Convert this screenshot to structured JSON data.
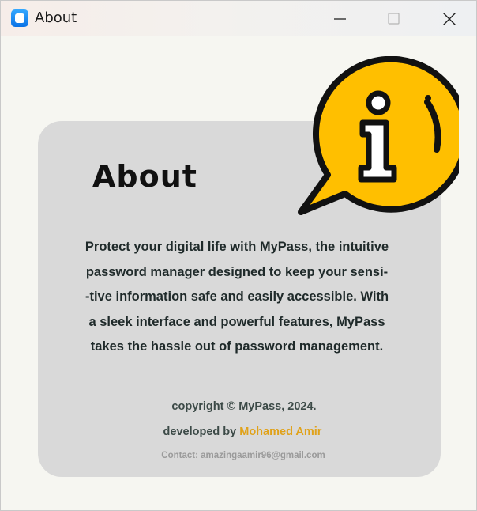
{
  "window": {
    "title": "About",
    "controls": {
      "minimize": "minimize",
      "maximize": "maximize",
      "close": "close"
    }
  },
  "about": {
    "heading": "About",
    "description": [
      "Protect your digital life with MyPass, the intuitive",
      "password manager designed to keep your sensi-",
      "-tive information safe and easily accessible. With",
      "a sleek interface and powerful features, MyPass",
      "takes the hassle out of password management."
    ],
    "copyright": "copyright © MyPass, 2024.",
    "developed_by": "developed by",
    "author": "Mohamed Amir",
    "contact": "Contact: amazingaamir96@gmail.com"
  },
  "icons": {
    "app": "app-icon",
    "info": "info-speech-bubble-icon"
  },
  "colors": {
    "card": "#d9d9d9",
    "author": "#e0a21a",
    "info_bubble": "#ffbf00"
  }
}
